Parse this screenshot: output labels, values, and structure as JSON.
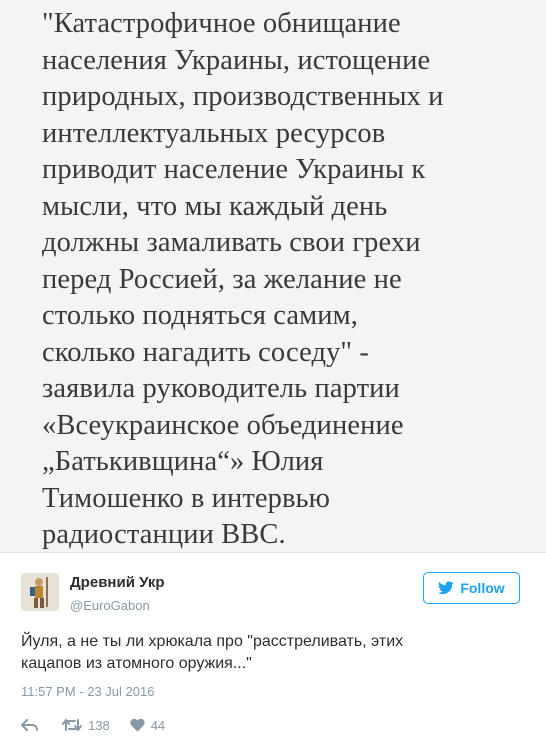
{
  "quote": {
    "text": "\"Катастрофичное обнищание\nнаселения Украины, истощение\nприродных, производственных и\nинтеллектуальных ресурсов\nприводит население Украины к\nмысли, что мы каждый день\nдолжны замаливать свои грехи\nперед Россией, за желание не\nстолько подняться самим,\nсколько нагадить соседу\" -\nзаявила руководитель партии\n«Всеукраинское объединение\n„Батькивщина“» Юлия\nТимошенко в интервью\nрадиостанции BBC."
  },
  "author": {
    "name": "Древний Укр",
    "handle": "@EuroGabon"
  },
  "follow": {
    "label": "Follow"
  },
  "tweet": {
    "text": "Йуля, а не ты ли хрюкала про \"расстреливать, этих\nкацапов из атомного оружия...\"",
    "timestamp": "11:57 PM - 23 Jul 2016"
  },
  "actions": {
    "retweets": "138",
    "likes": "44"
  },
  "colors": {
    "accent": "#1da1f2",
    "muted": "#8899a6",
    "text": "#292f33"
  }
}
